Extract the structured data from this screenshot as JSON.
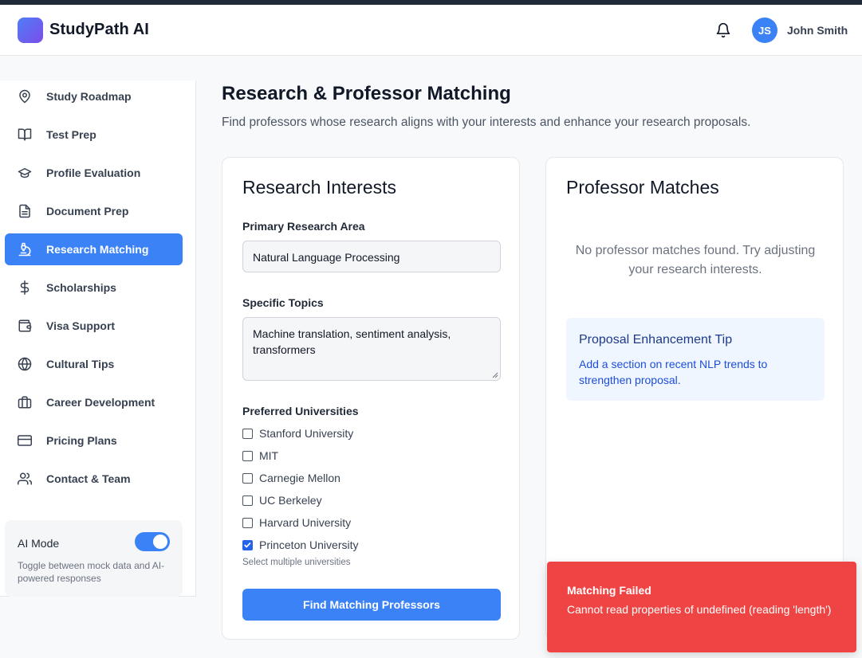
{
  "header": {
    "app_title": "StudyPath AI",
    "user_initials": "JS",
    "user_name": "John Smith",
    "icons": {
      "logo": "app-logo",
      "notifications": "bell-icon"
    }
  },
  "sidebar": {
    "items": [
      {
        "label": "Study Roadmap",
        "icon": "map-pin-icon",
        "active": false
      },
      {
        "label": "Test Prep",
        "icon": "book-open-icon",
        "active": false
      },
      {
        "label": "Profile Evaluation",
        "icon": "graduation-cap-icon",
        "active": false
      },
      {
        "label": "Document Prep",
        "icon": "file-text-icon",
        "active": false
      },
      {
        "label": "Research Matching",
        "icon": "microscope-icon",
        "active": true
      },
      {
        "label": "Scholarships",
        "icon": "dollar-sign-icon",
        "active": false
      },
      {
        "label": "Visa Support",
        "icon": "wallet-icon",
        "active": false
      },
      {
        "label": "Cultural Tips",
        "icon": "globe-icon",
        "active": false
      },
      {
        "label": "Career Development",
        "icon": "briefcase-icon",
        "active": false
      },
      {
        "label": "Pricing Plans",
        "icon": "credit-card-icon",
        "active": false
      },
      {
        "label": "Contact & Team",
        "icon": "users-icon",
        "active": false
      }
    ],
    "ai_mode": {
      "label": "AI Mode",
      "enabled": true,
      "description": "Toggle between mock data and AI-powered responses"
    }
  },
  "main": {
    "title": "Research & Professor Matching",
    "subtitle": "Find professors whose research aligns with your interests and enhance your research proposals."
  },
  "research_interests": {
    "title": "Research Interests",
    "primary_area_label": "Primary Research Area",
    "primary_area_value": "Natural Language Processing",
    "topics_label": "Specific Topics",
    "topics_value": "Machine translation, sentiment analysis, transformers",
    "universities_label": "Preferred Universities",
    "universities": [
      {
        "name": "Stanford University",
        "checked": false
      },
      {
        "name": "MIT",
        "checked": false
      },
      {
        "name": "Carnegie Mellon",
        "checked": false
      },
      {
        "name": "UC Berkeley",
        "checked": false
      },
      {
        "name": "Harvard University",
        "checked": false
      },
      {
        "name": "Princeton University",
        "checked": true
      }
    ],
    "universities_hint": "Select multiple universities",
    "submit_label": "Find Matching Professors"
  },
  "professor_matches": {
    "title": "Professor Matches",
    "empty_message": "No professor matches found. Try adjusting your research interests.",
    "tip_title": "Proposal Enhancement Tip",
    "tip_text": "Add a section on recent NLP trends to strengthen proposal."
  },
  "toast": {
    "title": "Matching Failed",
    "message": "Cannot read properties of undefined (reading 'length')"
  },
  "colors": {
    "accent": "#3b82f6",
    "error": "#ef4444",
    "tip_background": "#eff6ff"
  }
}
